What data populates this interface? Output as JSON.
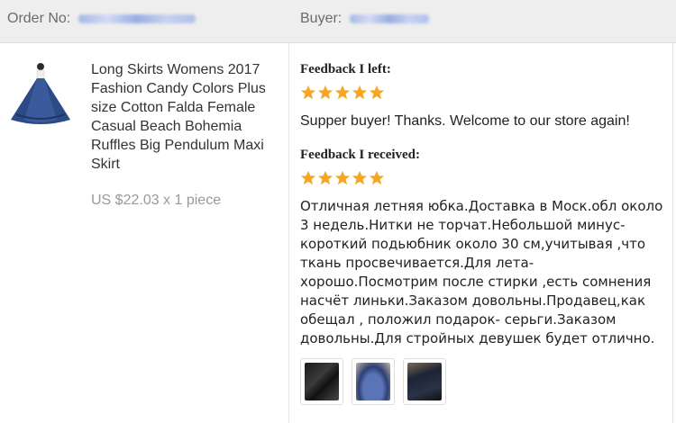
{
  "header": {
    "order_label": "Order No:",
    "buyer_label": "Buyer:"
  },
  "product": {
    "title": "Long Skirts Womens 2017 Fashion Candy Colors Plus size Cotton Falda Female Casual Beach Bohemia Ruffles Big Pendulum Maxi Skirt",
    "price": "US $22.03 x 1 piece"
  },
  "feedback_left": {
    "label": "Feedback I left:",
    "stars": 5,
    "text": "Supper buyer! Thanks. Welcome to our store again!"
  },
  "feedback_received": {
    "label": "Feedback I received:",
    "stars": 5,
    "text": "Отличная летняя юбка.Доставка в Моск.обл около 3 недель.Нитки не торчат.Небольшой минус- короткий подьюбник около 30 см,учитывая ,что ткань просвечивается.Для лета-хорошо.Посмотрим после стирки ,есть сомнения насчёт линьки.Заказом довольны.Продавец,как обещал , положил подарок- серьги.Заказом довольны.Для стройных девушек будет отлично."
  },
  "colors": {
    "star": "#f5a623",
    "header_bg": "#eeeeee"
  }
}
